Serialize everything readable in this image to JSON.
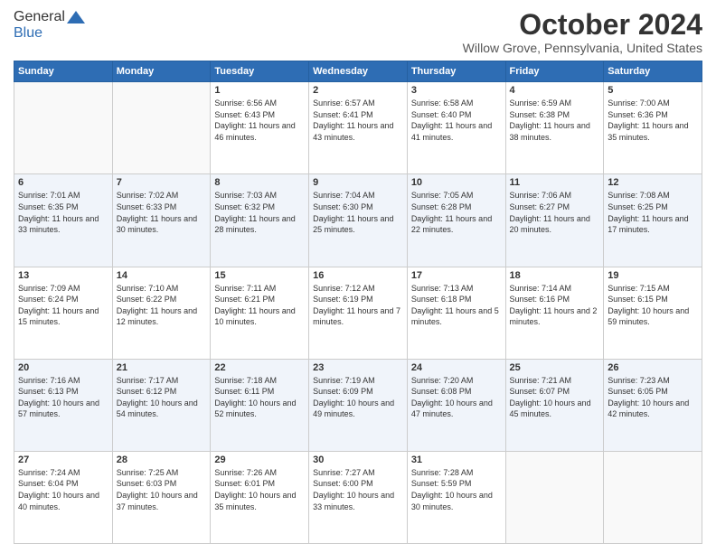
{
  "header": {
    "logo_general": "General",
    "logo_blue": "Blue",
    "month": "October 2024",
    "location": "Willow Grove, Pennsylvania, United States"
  },
  "days_of_week": [
    "Sunday",
    "Monday",
    "Tuesday",
    "Wednesday",
    "Thursday",
    "Friday",
    "Saturday"
  ],
  "weeks": [
    [
      {
        "day": "",
        "sunrise": "",
        "sunset": "",
        "daylight": ""
      },
      {
        "day": "",
        "sunrise": "",
        "sunset": "",
        "daylight": ""
      },
      {
        "day": "1",
        "sunrise": "Sunrise: 6:56 AM",
        "sunset": "Sunset: 6:43 PM",
        "daylight": "Daylight: 11 hours and 46 minutes."
      },
      {
        "day": "2",
        "sunrise": "Sunrise: 6:57 AM",
        "sunset": "Sunset: 6:41 PM",
        "daylight": "Daylight: 11 hours and 43 minutes."
      },
      {
        "day": "3",
        "sunrise": "Sunrise: 6:58 AM",
        "sunset": "Sunset: 6:40 PM",
        "daylight": "Daylight: 11 hours and 41 minutes."
      },
      {
        "day": "4",
        "sunrise": "Sunrise: 6:59 AM",
        "sunset": "Sunset: 6:38 PM",
        "daylight": "Daylight: 11 hours and 38 minutes."
      },
      {
        "day": "5",
        "sunrise": "Sunrise: 7:00 AM",
        "sunset": "Sunset: 6:36 PM",
        "daylight": "Daylight: 11 hours and 35 minutes."
      }
    ],
    [
      {
        "day": "6",
        "sunrise": "Sunrise: 7:01 AM",
        "sunset": "Sunset: 6:35 PM",
        "daylight": "Daylight: 11 hours and 33 minutes."
      },
      {
        "day": "7",
        "sunrise": "Sunrise: 7:02 AM",
        "sunset": "Sunset: 6:33 PM",
        "daylight": "Daylight: 11 hours and 30 minutes."
      },
      {
        "day": "8",
        "sunrise": "Sunrise: 7:03 AM",
        "sunset": "Sunset: 6:32 PM",
        "daylight": "Daylight: 11 hours and 28 minutes."
      },
      {
        "day": "9",
        "sunrise": "Sunrise: 7:04 AM",
        "sunset": "Sunset: 6:30 PM",
        "daylight": "Daylight: 11 hours and 25 minutes."
      },
      {
        "day": "10",
        "sunrise": "Sunrise: 7:05 AM",
        "sunset": "Sunset: 6:28 PM",
        "daylight": "Daylight: 11 hours and 22 minutes."
      },
      {
        "day": "11",
        "sunrise": "Sunrise: 7:06 AM",
        "sunset": "Sunset: 6:27 PM",
        "daylight": "Daylight: 11 hours and 20 minutes."
      },
      {
        "day": "12",
        "sunrise": "Sunrise: 7:08 AM",
        "sunset": "Sunset: 6:25 PM",
        "daylight": "Daylight: 11 hours and 17 minutes."
      }
    ],
    [
      {
        "day": "13",
        "sunrise": "Sunrise: 7:09 AM",
        "sunset": "Sunset: 6:24 PM",
        "daylight": "Daylight: 11 hours and 15 minutes."
      },
      {
        "day": "14",
        "sunrise": "Sunrise: 7:10 AM",
        "sunset": "Sunset: 6:22 PM",
        "daylight": "Daylight: 11 hours and 12 minutes."
      },
      {
        "day": "15",
        "sunrise": "Sunrise: 7:11 AM",
        "sunset": "Sunset: 6:21 PM",
        "daylight": "Daylight: 11 hours and 10 minutes."
      },
      {
        "day": "16",
        "sunrise": "Sunrise: 7:12 AM",
        "sunset": "Sunset: 6:19 PM",
        "daylight": "Daylight: 11 hours and 7 minutes."
      },
      {
        "day": "17",
        "sunrise": "Sunrise: 7:13 AM",
        "sunset": "Sunset: 6:18 PM",
        "daylight": "Daylight: 11 hours and 5 minutes."
      },
      {
        "day": "18",
        "sunrise": "Sunrise: 7:14 AM",
        "sunset": "Sunset: 6:16 PM",
        "daylight": "Daylight: 11 hours and 2 minutes."
      },
      {
        "day": "19",
        "sunrise": "Sunrise: 7:15 AM",
        "sunset": "Sunset: 6:15 PM",
        "daylight": "Daylight: 10 hours and 59 minutes."
      }
    ],
    [
      {
        "day": "20",
        "sunrise": "Sunrise: 7:16 AM",
        "sunset": "Sunset: 6:13 PM",
        "daylight": "Daylight: 10 hours and 57 minutes."
      },
      {
        "day": "21",
        "sunrise": "Sunrise: 7:17 AM",
        "sunset": "Sunset: 6:12 PM",
        "daylight": "Daylight: 10 hours and 54 minutes."
      },
      {
        "day": "22",
        "sunrise": "Sunrise: 7:18 AM",
        "sunset": "Sunset: 6:11 PM",
        "daylight": "Daylight: 10 hours and 52 minutes."
      },
      {
        "day": "23",
        "sunrise": "Sunrise: 7:19 AM",
        "sunset": "Sunset: 6:09 PM",
        "daylight": "Daylight: 10 hours and 49 minutes."
      },
      {
        "day": "24",
        "sunrise": "Sunrise: 7:20 AM",
        "sunset": "Sunset: 6:08 PM",
        "daylight": "Daylight: 10 hours and 47 minutes."
      },
      {
        "day": "25",
        "sunrise": "Sunrise: 7:21 AM",
        "sunset": "Sunset: 6:07 PM",
        "daylight": "Daylight: 10 hours and 45 minutes."
      },
      {
        "day": "26",
        "sunrise": "Sunrise: 7:23 AM",
        "sunset": "Sunset: 6:05 PM",
        "daylight": "Daylight: 10 hours and 42 minutes."
      }
    ],
    [
      {
        "day": "27",
        "sunrise": "Sunrise: 7:24 AM",
        "sunset": "Sunset: 6:04 PM",
        "daylight": "Daylight: 10 hours and 40 minutes."
      },
      {
        "day": "28",
        "sunrise": "Sunrise: 7:25 AM",
        "sunset": "Sunset: 6:03 PM",
        "daylight": "Daylight: 10 hours and 37 minutes."
      },
      {
        "day": "29",
        "sunrise": "Sunrise: 7:26 AM",
        "sunset": "Sunset: 6:01 PM",
        "daylight": "Daylight: 10 hours and 35 minutes."
      },
      {
        "day": "30",
        "sunrise": "Sunrise: 7:27 AM",
        "sunset": "Sunset: 6:00 PM",
        "daylight": "Daylight: 10 hours and 33 minutes."
      },
      {
        "day": "31",
        "sunrise": "Sunrise: 7:28 AM",
        "sunset": "Sunset: 5:59 PM",
        "daylight": "Daylight: 10 hours and 30 minutes."
      },
      {
        "day": "",
        "sunrise": "",
        "sunset": "",
        "daylight": ""
      },
      {
        "day": "",
        "sunrise": "",
        "sunset": "",
        "daylight": ""
      }
    ]
  ]
}
